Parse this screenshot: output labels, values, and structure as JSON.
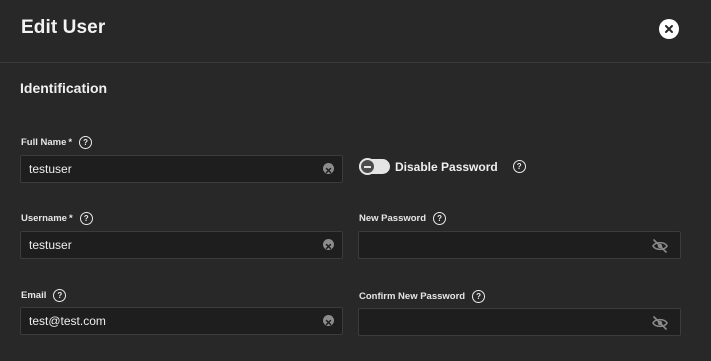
{
  "dialog": {
    "title": "Edit User",
    "close_icon": "close-icon"
  },
  "section": {
    "title": "Identification"
  },
  "fields": {
    "full_name": {
      "label": "Full Name",
      "required": "*",
      "value": "testuser",
      "help_icon": "help-icon",
      "clear_icon": "clear-icon"
    },
    "username": {
      "label": "Username",
      "required": "*",
      "value": "testuser",
      "help_icon": "help-icon",
      "clear_icon": "clear-icon"
    },
    "email": {
      "label": "Email",
      "value": "test@test.com",
      "help_icon": "help-icon",
      "clear_icon": "clear-icon"
    },
    "disable_password": {
      "label": "Disable Password",
      "checked": false,
      "help_icon": "help-icon"
    },
    "new_password": {
      "label": "New Password",
      "value": "",
      "help_icon": "help-icon",
      "visibility_icon": "eye-off-icon"
    },
    "confirm_password": {
      "label": "Confirm New Password",
      "value": "",
      "help_icon": "help-icon",
      "visibility_icon": "eye-off-icon"
    }
  },
  "colors": {
    "background": "#282828",
    "input_background": "#1e1e1e",
    "text": "#eeeeee"
  }
}
